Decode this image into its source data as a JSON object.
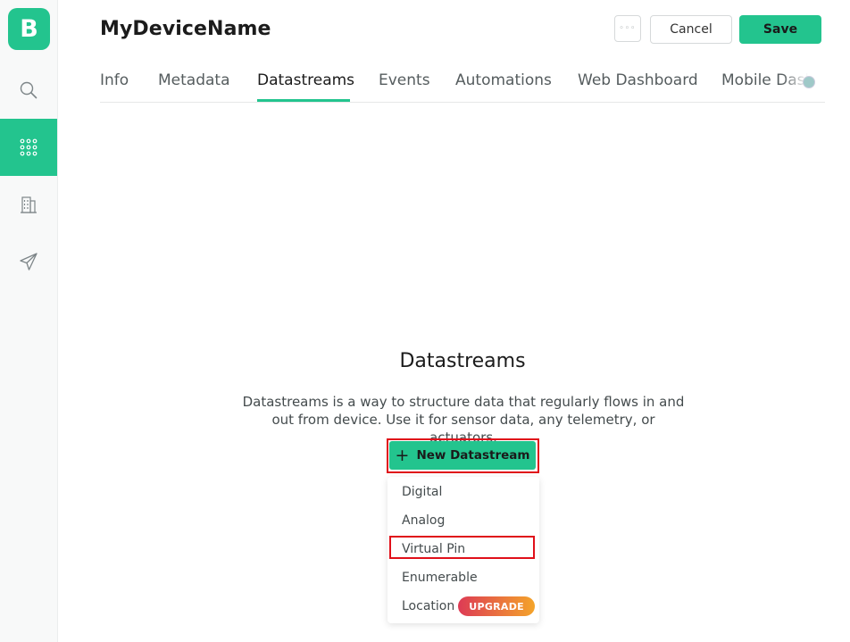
{
  "sidebar": {
    "logo": "B",
    "items": [
      {
        "icon": "search-icon",
        "active": false
      },
      {
        "icon": "grid-icon",
        "active": true
      },
      {
        "icon": "building-icon",
        "active": false
      },
      {
        "icon": "paper-plane-icon",
        "active": false
      }
    ]
  },
  "header": {
    "title": "MyDeviceName",
    "more_label": "◦◦◦",
    "cancel_label": "Cancel",
    "save_label": "Save"
  },
  "tabs": [
    {
      "label": "Info",
      "active": false
    },
    {
      "label": "Metadata",
      "active": false
    },
    {
      "label": "Datastreams",
      "active": true
    },
    {
      "label": "Events",
      "active": false
    },
    {
      "label": "Automations",
      "active": false
    },
    {
      "label": "Web Dashboard",
      "active": false
    },
    {
      "label": "Mobile Dashboard",
      "active": false
    }
  ],
  "empty_state": {
    "title": "Datastreams",
    "description": "Datastreams is a way to structure data that regularly flows in and out from device. Use it for sensor data, any telemetry, or actuators.",
    "button_label": "New Datastream"
  },
  "dropdown": {
    "items": [
      {
        "label": "Digital"
      },
      {
        "label": "Analog"
      },
      {
        "label": "Virtual Pin",
        "highlighted": true
      },
      {
        "label": "Enumerable"
      },
      {
        "label": "Location",
        "badge": "UPGRADE"
      }
    ]
  },
  "colors": {
    "accent": "#23c48e",
    "highlight": "#e0101a",
    "badge_start": "#dd3a55",
    "badge_end": "#f4a42a"
  }
}
